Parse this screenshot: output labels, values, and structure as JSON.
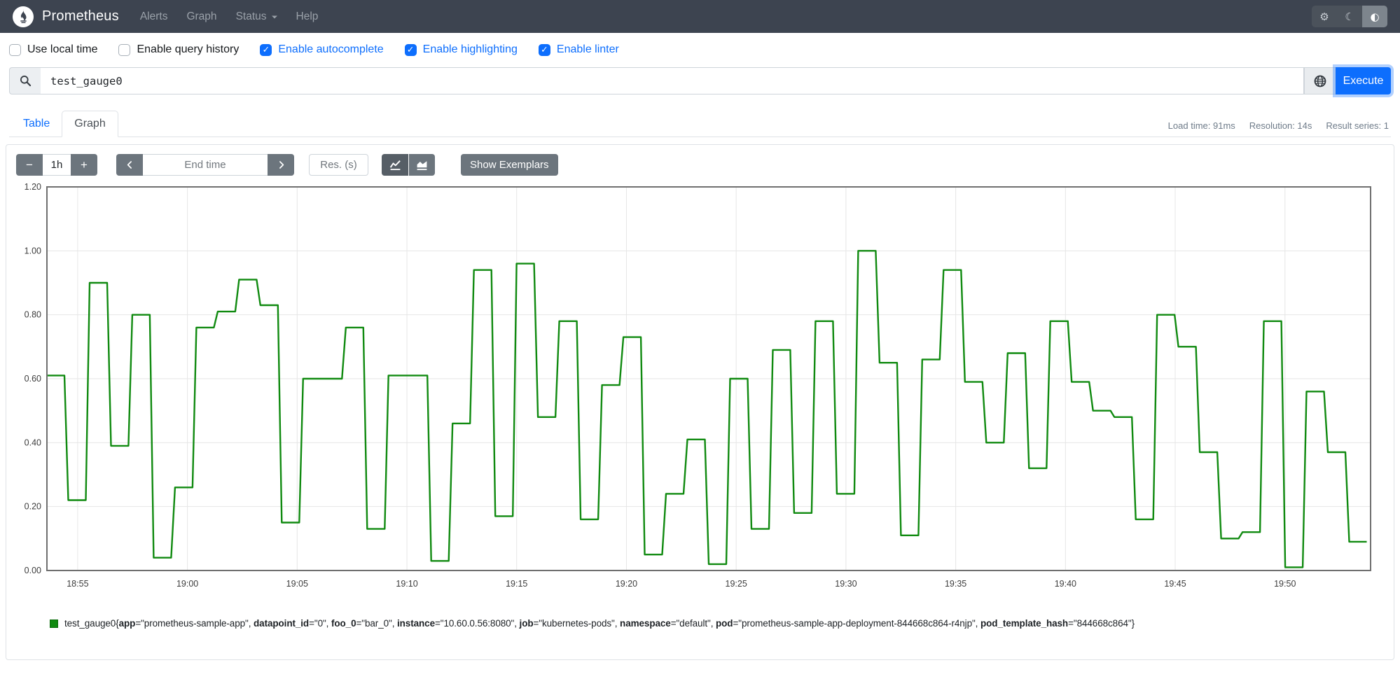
{
  "navbar": {
    "brand": "Prometheus",
    "links": [
      {
        "label": "Alerts"
      },
      {
        "label": "Graph"
      },
      {
        "label": "Status",
        "dropdown": true
      },
      {
        "label": "Help"
      }
    ],
    "theme_toggle": {
      "buttons": [
        {
          "name": "settings",
          "icon": "gear-icon",
          "glyph": "⚙",
          "active": false
        },
        {
          "name": "dark-mode",
          "icon": "moon-icon",
          "glyph": "☾",
          "active": false
        },
        {
          "name": "auto-theme",
          "icon": "contrast-icon",
          "glyph": "◐",
          "active": true
        }
      ]
    }
  },
  "options": {
    "checkboxes": [
      {
        "label": "Use local time",
        "checked": false
      },
      {
        "label": "Enable query history",
        "checked": false
      },
      {
        "label": "Enable autocomplete",
        "checked": true
      },
      {
        "label": "Enable highlighting",
        "checked": true
      },
      {
        "label": "Enable linter",
        "checked": true
      }
    ]
  },
  "query_bar": {
    "value": "test_gauge0",
    "execute_label": "Execute"
  },
  "tabs": [
    {
      "label": "Table",
      "active": false
    },
    {
      "label": "Graph",
      "active": true
    }
  ],
  "stats": [
    "Load time: 91ms",
    "Resolution: 14s",
    "Result series: 1"
  ],
  "graph_controls": {
    "minus_label": "−",
    "range_value": "1h",
    "plus_label": "+",
    "end_time_placeholder": "End time",
    "resolution_placeholder": "Res. (s)",
    "show_exemplars_label": "Show Exemplars"
  },
  "chart_data": {
    "type": "line",
    "line_style": "step",
    "title": "",
    "xlabel": "",
    "ylabel": "",
    "grid": true,
    "ylim": [
      0,
      1.2
    ],
    "yticks": [
      "0.00",
      "0.20",
      "0.40",
      "0.60",
      "0.80",
      "1.00",
      "1.20"
    ],
    "xticks": [
      "18:55",
      "19:00",
      "19:05",
      "19:10",
      "19:15",
      "19:20",
      "19:25",
      "19:30",
      "19:35",
      "19:40",
      "19:45",
      "19:50"
    ],
    "x_axis": {
      "start": "18:53.5",
      "end": "19:53.8",
      "first_tick_offset_min": 1.4,
      "tick_interval_min": 5,
      "span_min": 60.3
    },
    "series": [
      {
        "name": "test_gauge0",
        "color": "#108A10",
        "samples": [
          {
            "t": "18:54",
            "v": 0.61
          },
          {
            "t": "18:55",
            "v": 0.22
          },
          {
            "t": "18:56",
            "v": 0.9
          },
          {
            "t": "18:57",
            "v": 0.39
          },
          {
            "t": "18:58",
            "v": 0.8
          },
          {
            "t": "18:59",
            "v": 0.04
          },
          {
            "t": "19:00",
            "v": 0.26
          },
          {
            "t": "19:01",
            "v": 0.76
          },
          {
            "t": "19:02",
            "v": 0.81
          },
          {
            "t": "19:03",
            "v": 0.91
          },
          {
            "t": "19:04",
            "v": 0.83
          },
          {
            "t": "19:05",
            "v": 0.15
          },
          {
            "t": "19:06",
            "v": 0.6
          },
          {
            "t": "19:07",
            "v": 0.6
          },
          {
            "t": "19:08",
            "v": 0.76
          },
          {
            "t": "19:09",
            "v": 0.13
          },
          {
            "t": "19:10",
            "v": 0.61
          },
          {
            "t": "19:11",
            "v": 0.61
          },
          {
            "t": "19:12",
            "v": 0.03
          },
          {
            "t": "19:13",
            "v": 0.46
          },
          {
            "t": "19:14",
            "v": 0.94
          },
          {
            "t": "19:15",
            "v": 0.17
          },
          {
            "t": "19:16",
            "v": 0.96
          },
          {
            "t": "19:17",
            "v": 0.48
          },
          {
            "t": "19:18",
            "v": 0.78
          },
          {
            "t": "19:19",
            "v": 0.16
          },
          {
            "t": "19:20",
            "v": 0.58
          },
          {
            "t": "19:21",
            "v": 0.73
          },
          {
            "t": "19:22",
            "v": 0.05
          },
          {
            "t": "19:23",
            "v": 0.24
          },
          {
            "t": "19:24",
            "v": 0.41
          },
          {
            "t": "19:25",
            "v": 0.02
          },
          {
            "t": "19:26",
            "v": 0.6
          },
          {
            "t": "19:27",
            "v": 0.13
          },
          {
            "t": "19:28",
            "v": 0.69
          },
          {
            "t": "19:29",
            "v": 0.18
          },
          {
            "t": "19:30",
            "v": 0.78
          },
          {
            "t": "19:31",
            "v": 0.24
          },
          {
            "t": "19:32",
            "v": 1.0
          },
          {
            "t": "19:33",
            "v": 0.65
          },
          {
            "t": "19:34",
            "v": 0.11
          },
          {
            "t": "19:35",
            "v": 0.66
          },
          {
            "t": "19:36",
            "v": 0.94
          },
          {
            "t": "19:37",
            "v": 0.59
          },
          {
            "t": "19:38",
            "v": 0.4
          },
          {
            "t": "19:39",
            "v": 0.68
          },
          {
            "t": "19:40",
            "v": 0.32
          },
          {
            "t": "19:41",
            "v": 0.78
          },
          {
            "t": "19:42",
            "v": 0.59
          },
          {
            "t": "19:43",
            "v": 0.5
          },
          {
            "t": "19:44",
            "v": 0.48
          },
          {
            "t": "19:45",
            "v": 0.16
          },
          {
            "t": "19:46",
            "v": 0.8
          },
          {
            "t": "19:47",
            "v": 0.7
          },
          {
            "t": "19:48",
            "v": 0.37
          },
          {
            "t": "19:49",
            "v": 0.1
          },
          {
            "t": "19:50",
            "v": 0.12
          },
          {
            "t": "19:51",
            "v": 0.78
          },
          {
            "t": "19:52",
            "v": 0.01
          },
          {
            "t": "19:53",
            "v": 0.56
          },
          {
            "t": "19:54",
            "v": 0.37
          },
          {
            "t": "19:55",
            "v": 0.09
          }
        ]
      }
    ]
  },
  "legend": {
    "metric": "test_gauge0",
    "labels": [
      {
        "key": "app",
        "value": "prometheus-sample-app"
      },
      {
        "key": "datapoint_id",
        "value": "0"
      },
      {
        "key": "foo_0",
        "value": "bar_0"
      },
      {
        "key": "instance",
        "value": "10.60.0.56:8080"
      },
      {
        "key": "job",
        "value": "kubernetes-pods"
      },
      {
        "key": "namespace",
        "value": "default"
      },
      {
        "key": "pod",
        "value": "prometheus-sample-app-deployment-844668c864-r4njp"
      },
      {
        "key": "pod_template_hash",
        "value": "844668c864"
      }
    ]
  },
  "colors": {
    "accent_blue": "#0d6efd",
    "navbar_bg": "#3d4450",
    "secondary_gray": "#6c757d",
    "series_green": "#108A10"
  }
}
